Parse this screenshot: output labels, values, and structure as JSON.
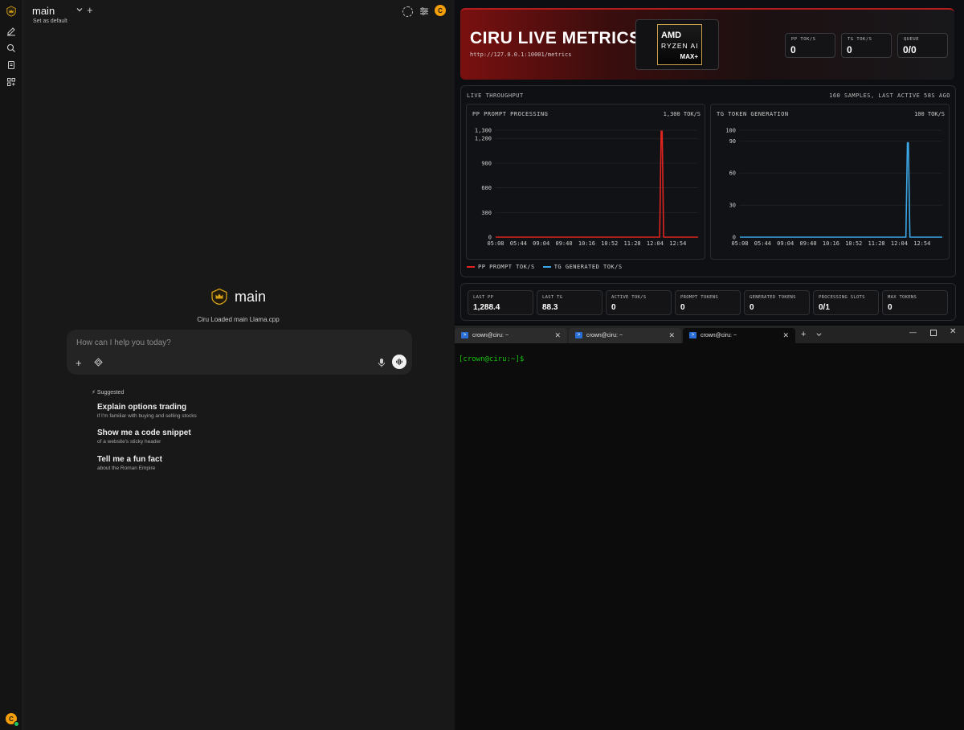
{
  "colors": {
    "accent": "#f59e0b",
    "pp": "#e0241f",
    "tg": "#3ba7e6",
    "terminal_green": "#16c60c"
  },
  "chat": {
    "model_name": "main",
    "set_default": "Set as default",
    "hero_title": "main",
    "hero_subtitle": "Ciru Loaded main Llama.cpp",
    "composer_placeholder": "How can I help you today?",
    "avatar_initial": "C",
    "suggested_label": "Suggested",
    "suggestions": [
      {
        "title": "Explain options trading",
        "subtitle": "if I'm familiar with buying and selling stocks"
      },
      {
        "title": "Show me a code snippet",
        "subtitle": "of a website's sticky header"
      },
      {
        "title": "Tell me a fun fact",
        "subtitle": "about the Roman Empire"
      }
    ],
    "icons": [
      "crown-logo-icon",
      "new-chat-icon",
      "search-icon",
      "notes-icon",
      "workspace-icon",
      "dashed-circle-icon",
      "sliders-icon",
      "plus-icon",
      "tools-icon",
      "mic-icon",
      "voice-wave-icon",
      "sparkle-icon"
    ]
  },
  "metrics": {
    "title": "CIRU LIVE METRICS",
    "url": "http://127.0.0.1:10001/metrics",
    "amd": {
      "line1": "AMD",
      "line2": "RYZEN AI",
      "line3": "MAX+"
    },
    "header_stats": [
      {
        "label": "PP TOK/S",
        "value": "0"
      },
      {
        "label": "TG TOK/S",
        "value": "0"
      },
      {
        "label": "QUEUE",
        "value": "0/0"
      }
    ],
    "throughput_label": "LIVE THROUGHPUT",
    "samples_text": "160 SAMPLES, LAST ACTIVE 58S AGO",
    "legend": [
      "PP PROMPT TOK/S",
      "TG GENERATED TOK/S"
    ],
    "stats": [
      {
        "label": "LAST PP",
        "value": "1,288.4"
      },
      {
        "label": "LAST TG",
        "value": "88.3"
      },
      {
        "label": "ACTIVE TOK/S",
        "value": "0"
      },
      {
        "label": "PROMPT TOKENS",
        "value": "0"
      },
      {
        "label": "GENERATED TOKENS",
        "value": "0"
      },
      {
        "label": "PROCESSING SLOTS",
        "value": "0/1"
      },
      {
        "label": "MAX TOKENS",
        "value": "0"
      }
    ]
  },
  "chart_data": [
    {
      "type": "line",
      "title": "PP PROMPT PROCESSING",
      "peak_label": "1,300 TOK/S",
      "series": [
        {
          "name": "PP PROMPT TOK/S",
          "color": "#e0241f"
        }
      ],
      "x_tick_labels": [
        "05:08",
        "05:44",
        "09:04",
        "09:40",
        "10:16",
        "10:52",
        "11:28",
        "12:04",
        "12:54"
      ],
      "y_tick_labels": [
        "0",
        "300",
        "600",
        "900",
        "1,200",
        "1,300"
      ],
      "y_ticks": [
        0,
        300,
        600,
        900,
        1200,
        1300
      ],
      "ylim": [
        0,
        1300
      ],
      "grid": true,
      "baseline": 0,
      "spike": {
        "position": 0.82,
        "value": 1288.4
      }
    },
    {
      "type": "line",
      "title": "TG TOKEN GENERATION",
      "peak_label": "100 TOK/S",
      "series": [
        {
          "name": "TG GENERATED TOK/S",
          "color": "#3ba7e6"
        }
      ],
      "x_tick_labels": [
        "05:08",
        "05:44",
        "09:04",
        "09:40",
        "10:16",
        "10:52",
        "11:28",
        "12:04",
        "12:54"
      ],
      "y_tick_labels": [
        "0",
        "30",
        "60",
        "90",
        "100"
      ],
      "y_ticks": [
        0,
        30,
        60,
        90,
        100
      ],
      "ylim": [
        0,
        100
      ],
      "grid": true,
      "baseline": 0,
      "spike": {
        "position": 0.83,
        "value": 88.3
      }
    }
  ],
  "terminal": {
    "tabs": [
      {
        "label": "crown@ciru: ~",
        "active": false
      },
      {
        "label": "crown@ciru: ~",
        "active": false
      },
      {
        "label": "crown@ciru: ~",
        "active": true
      }
    ],
    "prompt": "[crown@ciru:~]$"
  }
}
